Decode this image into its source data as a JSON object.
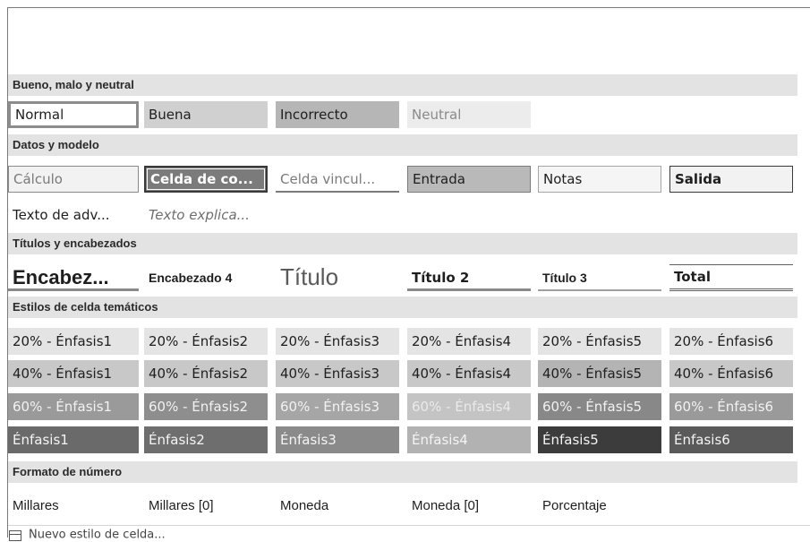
{
  "sections": {
    "bueno": "Bueno, malo y neutral",
    "datos": "Datos y modelo",
    "titulos": "Títulos y encabezados",
    "tematicos": "Estilos de celda temáticos",
    "formato": "Formato de número"
  },
  "bueno_styles": [
    "Normal",
    "Buena",
    "Incorrecto",
    "Neutral"
  ],
  "datos_styles": [
    "Cálculo",
    "Celda de co...",
    "Celda vincul...",
    "Entrada",
    "Notas",
    "Salida"
  ],
  "datos_styles_2": [
    "Texto de adv...",
    "Texto explica..."
  ],
  "titulos_styles": [
    "Encabez...",
    "Encabezado 4",
    "Título",
    "Título 2",
    "Título 3",
    "Total"
  ],
  "tematicos": {
    "row20": [
      "20% - Énfasis1",
      "20% - Énfasis2",
      "20% - Énfasis3",
      "20% - Énfasis4",
      "20% - Énfasis5",
      "20% - Énfasis6"
    ],
    "row40": [
      "40% - Énfasis1",
      "40% - Énfasis2",
      "40% - Énfasis3",
      "40% - Énfasis4",
      "40% - Énfasis5",
      "40% - Énfasis6"
    ],
    "row60": [
      "60% - Énfasis1",
      "60% - Énfasis2",
      "60% - Énfasis3",
      "60% - Énfasis4",
      "60% - Énfasis5",
      "60% - Énfasis6"
    ],
    "rowFull": [
      "Énfasis1",
      "Énfasis2",
      "Énfasis3",
      "Énfasis4",
      "Énfasis5",
      "Énfasis6"
    ]
  },
  "formato_styles": [
    "Millares",
    "Millares [0]",
    "Moneda",
    "Moneda [0]",
    "Porcentaje"
  ],
  "footer": {
    "icon": "new-cell-style-icon",
    "label": "Nuevo estilo de celda..."
  }
}
